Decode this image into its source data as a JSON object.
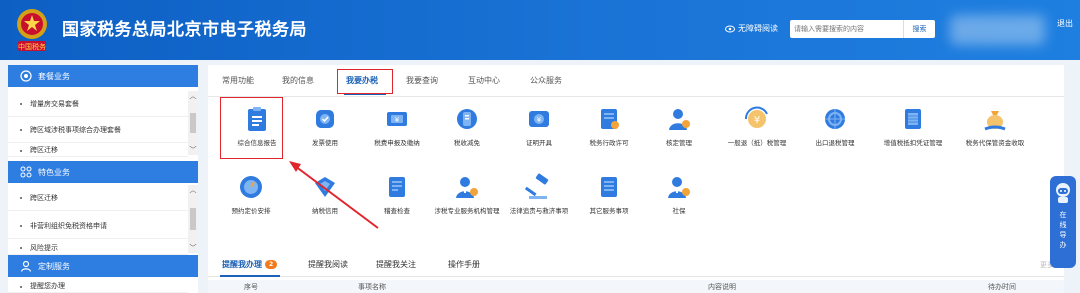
{
  "header": {
    "title": "国家税务总局北京市电子税务局",
    "emblem_text": "中国税务",
    "accessibility_label": "无障碍阅读",
    "search": {
      "placeholder": "请输入需要搜索的内容",
      "button_label": "搜索"
    },
    "logout_label": "退出",
    "colors": {
      "bar": "#1565c8",
      "accent": "#e0262c"
    }
  },
  "sidebar": {
    "sections": [
      {
        "title": "套餐业务",
        "icon": "package-icon",
        "items": [
          "增量房交易套餐",
          "跨区域涉税事项综合办理套餐",
          "跨区迁移"
        ]
      },
      {
        "title": "特色业务",
        "icon": "grid-icon",
        "items": [
          "跨区迁移",
          "非营利组织免税资格申请",
          "风险提示"
        ]
      },
      {
        "title": "定制服务",
        "icon": "user-icon",
        "items": [
          "提醒您办理"
        ]
      }
    ]
  },
  "main": {
    "tabs": [
      "常用功能",
      "我的信息",
      "我要办税",
      "我要查询",
      "互动中心",
      "公众服务"
    ],
    "active_tab": "我要办税",
    "functions": [
      {
        "label": "综合信息报告",
        "icon": "clipboard-icon"
      },
      {
        "label": "发票使用",
        "icon": "invoice-icon"
      },
      {
        "label": "税费申报及缴纳",
        "icon": "payment-icon"
      },
      {
        "label": "税收减免",
        "icon": "tax-reduction-icon"
      },
      {
        "label": "证明开具",
        "icon": "certificate-icon"
      },
      {
        "label": "税务行政许可",
        "icon": "admin-permit-icon"
      },
      {
        "label": "核定管理",
        "icon": "assessment-icon"
      },
      {
        "label": "一般退（抵）税管理",
        "icon": "refund-icon"
      },
      {
        "label": "出口退税管理",
        "icon": "export-refund-icon"
      },
      {
        "label": "增值税抵扣凭证管理",
        "icon": "vat-voucher-icon"
      },
      {
        "label": "税务代保管资金收取",
        "icon": "money-bag-icon"
      },
      {
        "label": "预约定价安排",
        "icon": "compass-icon"
      },
      {
        "label": "纳税信用",
        "icon": "credit-icon"
      },
      {
        "label": "稽查检查",
        "icon": "inspection-icon"
      },
      {
        "label": "涉税专业服务机构管理",
        "icon": "agency-icon"
      },
      {
        "label": "法律追责与救济事项",
        "icon": "gavel-icon"
      },
      {
        "label": "其它服务事项",
        "icon": "other-services-icon"
      },
      {
        "label": "社保",
        "icon": "social-security-icon"
      }
    ],
    "bottom_tabs": [
      {
        "label": "提醒我办理",
        "badge": "2"
      },
      {
        "label": "提醒我阅读"
      },
      {
        "label": "提醒我关注"
      },
      {
        "label": "操作手册"
      }
    ],
    "more_label": "更多",
    "table_headers": [
      "序号",
      "事项名称",
      "内容说明",
      "待办时间"
    ]
  },
  "float_widget": {
    "text": "在线导办"
  }
}
